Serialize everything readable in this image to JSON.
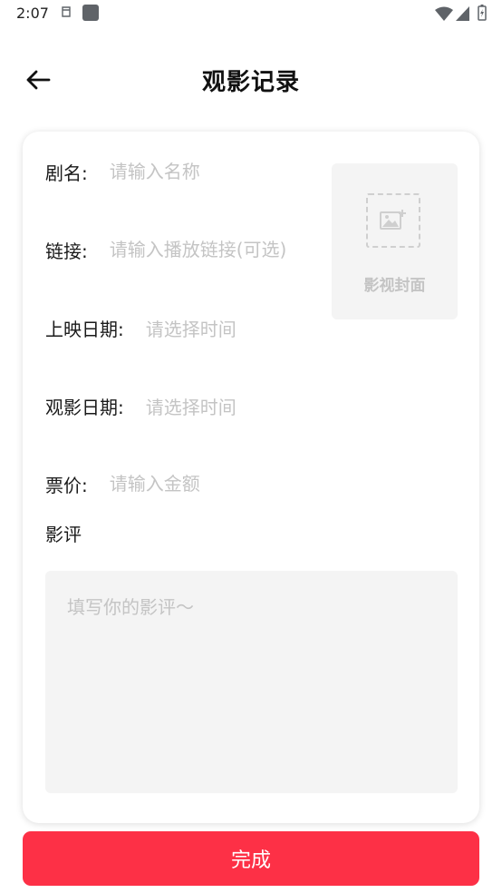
{
  "status_bar": {
    "time": "2:07",
    "icons": [
      "notification-icon",
      "app-icon",
      "wifi-icon",
      "signal-icon",
      "battery-icon"
    ]
  },
  "header": {
    "title": "观影记录",
    "back_icon": "arrow-left-icon"
  },
  "form": {
    "name": {
      "label": "剧名:",
      "placeholder": "请输入名称",
      "value": ""
    },
    "link": {
      "label": "链接:",
      "placeholder": "请输入播放链接(可选)",
      "value": ""
    },
    "release_date": {
      "label": "上映日期:",
      "placeholder": "请选择时间"
    },
    "watch_date": {
      "label": "观影日期:",
      "placeholder": "请选择时间"
    },
    "price": {
      "label": "票价:",
      "placeholder": "请输入金额",
      "value": ""
    },
    "cover": {
      "label": "影视封面",
      "icon": "add-image-icon"
    },
    "review": {
      "label": "影评",
      "placeholder": "填写你的影评～",
      "value": ""
    }
  },
  "submit": {
    "label": "完成"
  },
  "colors": {
    "accent": "#fd3046",
    "placeholder": "#c4c4c4",
    "field_background": "#f4f4f4"
  }
}
